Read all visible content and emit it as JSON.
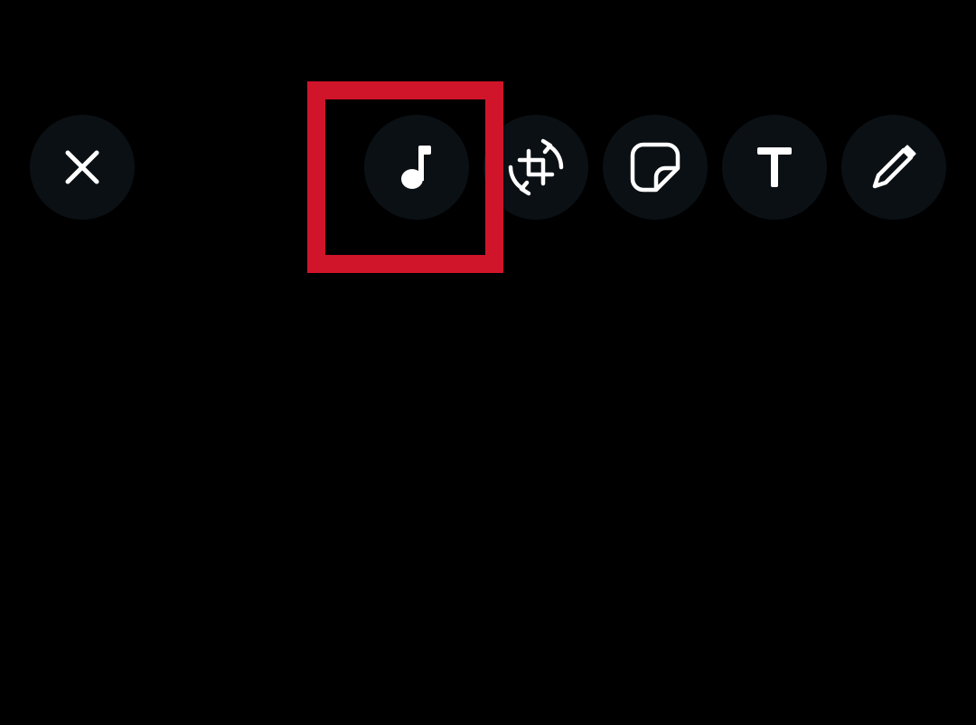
{
  "toolbar": {
    "buttons": [
      {
        "id": "close",
        "icon": "close-icon"
      },
      {
        "id": "music",
        "icon": "music-note-icon"
      },
      {
        "id": "crop-rotate",
        "icon": "crop-rotate-icon"
      },
      {
        "id": "sticker",
        "icon": "sticker-icon"
      },
      {
        "id": "text",
        "icon": "text-icon"
      },
      {
        "id": "draw",
        "icon": "pencil-icon"
      }
    ]
  },
  "colors": {
    "background": "#000000",
    "button_fill": "#0b1014",
    "icon": "#ffffff",
    "highlight": "#d0142a"
  }
}
